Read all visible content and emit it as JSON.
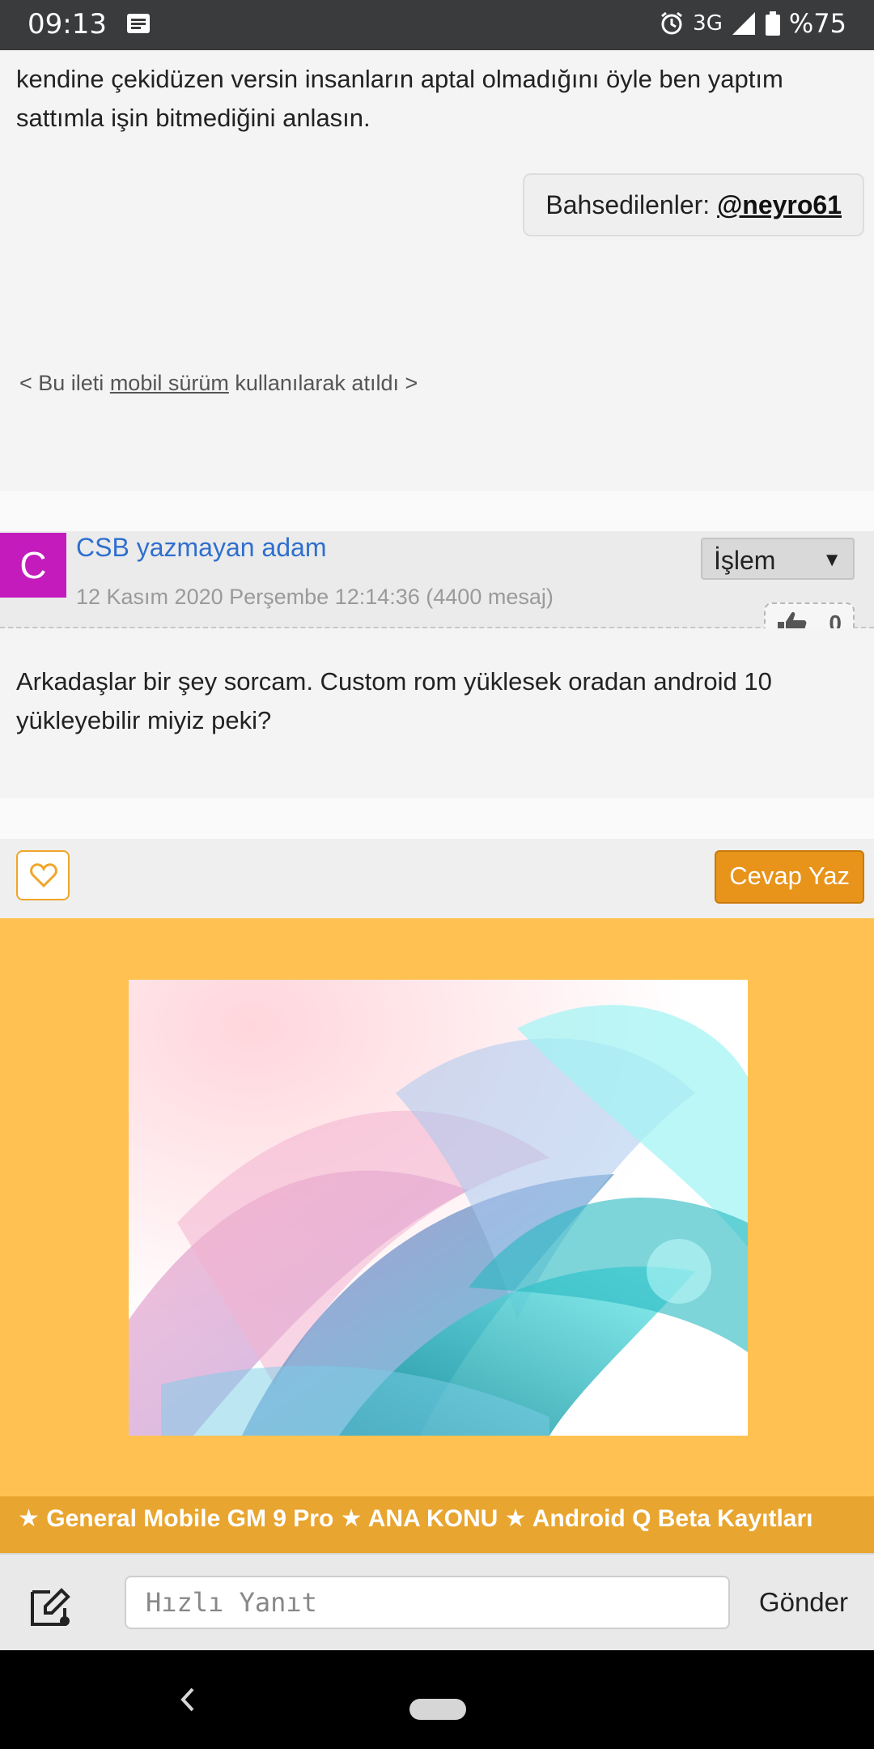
{
  "status_bar": {
    "time": "09:13",
    "network": "3G",
    "battery": "%75",
    "icons": [
      "message-icon",
      "alarm-icon",
      "signal-icon",
      "battery-icon"
    ]
  },
  "previous_post": {
    "line1": "kendine çekidüzen versin insanların aptal olmadığını öyle ben yaptım",
    "line2": "sattımla işin bitmediğini anlasın.",
    "mention_label": "Bahsedilenler:",
    "mention_user": "@neyro61",
    "mobile_note_prefix": "< Bu ileti ",
    "mobile_note_link": "mobil sürüm",
    "mobile_note_suffix": " kullanılarak atıldı >"
  },
  "post": {
    "avatar_letter": "C",
    "avatar_color": "#c41bbd",
    "author": "CSB yazmayan adam",
    "date": "12 Kasım 2020 Perşembe 12:14:36 (4400 mesaj)",
    "action_select": "İşlem",
    "like_count": "0",
    "body_line1": "Arkadaşlar bir şey sorcam. Custom rom yüklesek oradan android 10",
    "body_line2": "yükleyebilir miyiz peki?"
  },
  "actions": {
    "reply_label": "Cevap Yaz",
    "accent_color": "#e8931a"
  },
  "topic_banner": {
    "title": "★ General Mobile GM 9 Pro ★ ANA KONU ★ Android Q Beta Kayıtları"
  },
  "quick_reply": {
    "placeholder": "Hızlı Yanıt",
    "send_label": "Gönder"
  }
}
